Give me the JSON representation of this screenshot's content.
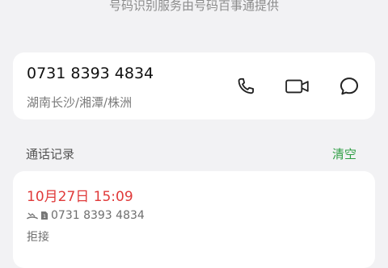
{
  "header": {
    "provider_note": "号码识别服务由号码百事通提供"
  },
  "contact": {
    "phone_number": "0731 8393 4834",
    "location": "湖南长沙/湘潭/株洲",
    "actions": {
      "call_icon": "phone-icon",
      "video_icon": "video-camera-icon",
      "message_icon": "message-bubble-icon"
    }
  },
  "call_log": {
    "title": "通话记录",
    "clear_label": "清空",
    "accent_color": "#2f9e44",
    "records": [
      {
        "time": "10月27日 15:09",
        "time_color": "#e03a3a",
        "number": "0731 8393 4834",
        "icons": [
          "missed-call-icon",
          "sim-card-icon"
        ],
        "status": "拒接"
      }
    ]
  }
}
